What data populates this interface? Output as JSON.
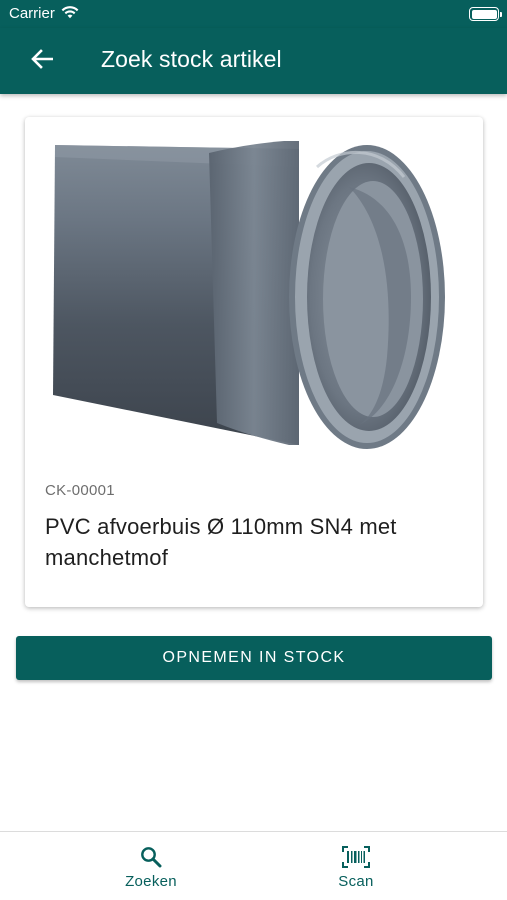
{
  "status_bar": {
    "carrier": "Carrier"
  },
  "app_bar": {
    "title": "Zoek stock artikel",
    "back_icon": "arrow-left-icon"
  },
  "product": {
    "image": "pvc-pipe-photo",
    "sku": "CK-00001",
    "name": "PVC afvoerbuis Ø 110mm SN4 met manchetmof"
  },
  "actions": {
    "primary_label": "OPNEMEN IN STOCK"
  },
  "tab_bar": {
    "tabs": [
      {
        "label": "Zoeken",
        "icon": "search-icon"
      },
      {
        "label": "Scan",
        "icon": "barcode-icon"
      }
    ]
  },
  "colors": {
    "primary": "#075f5c",
    "background": "#ffffff",
    "secondary_text": "#6e6e6e"
  }
}
